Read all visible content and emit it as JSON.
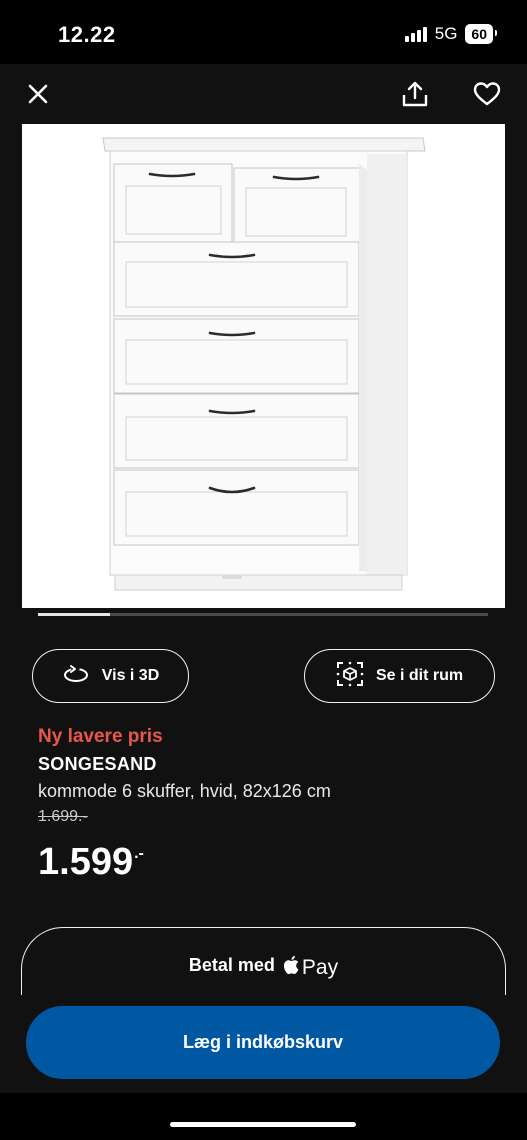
{
  "status": {
    "time": "12.22",
    "network": "5G",
    "battery": "60"
  },
  "icons": {
    "close": "close-icon",
    "share": "share-icon",
    "favorite": "heart-icon",
    "rotate": "rotate-3d-icon",
    "ar": "ar-room-icon",
    "apple": "apple-logo-icon"
  },
  "gallery": {
    "progress": 0.16
  },
  "actions": {
    "view_3d": "Vis i 3D",
    "view_room": "Se i dit rum"
  },
  "product": {
    "badge": "Ny lavere pris",
    "name": "SONGESAND",
    "description": "kommode 6 skuffer, hvid, 82x126 cm",
    "old_price": "1.699.-",
    "price": "1.599",
    "price_suffix": ".-"
  },
  "checkout": {
    "apple_pay_label": "Betal med",
    "apple_pay_brand": "Pay",
    "add_to_cart": "Læg i indkøbskurv"
  },
  "colors": {
    "accent": "#0058a3",
    "sale": "#e8574b",
    "background": "#111111"
  }
}
